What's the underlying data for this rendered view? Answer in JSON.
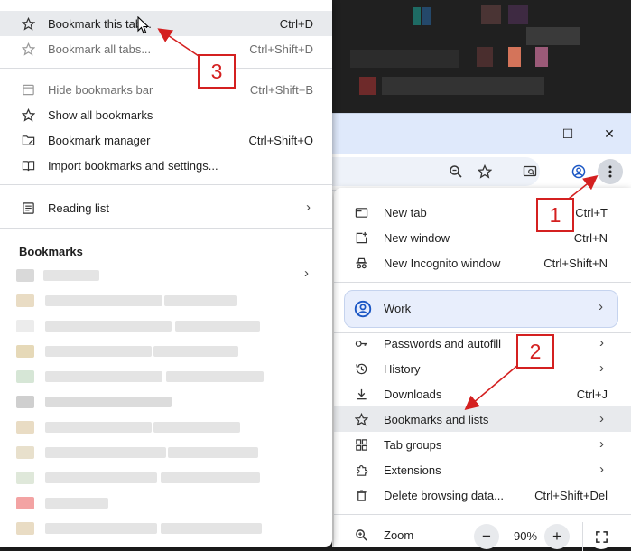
{
  "browser": {
    "window_controls": [
      "minimize",
      "maximize",
      "close"
    ]
  },
  "main_menu": {
    "items": [
      {
        "label": "New tab",
        "shortcut": "Ctrl+T",
        "icon": "new-tab-icon"
      },
      {
        "label": "New window",
        "shortcut": "Ctrl+N",
        "icon": "new-window-icon"
      },
      {
        "label": "New Incognito window",
        "shortcut": "Ctrl+Shift+N",
        "icon": "incognito-icon"
      },
      {
        "label": "Passwords and autofill",
        "icon": "key-icon"
      },
      {
        "label": "History",
        "icon": "history-icon"
      },
      {
        "label": "Downloads",
        "shortcut": "Ctrl+J",
        "icon": "download-icon"
      },
      {
        "label": "Bookmarks and lists",
        "icon": "star-icon",
        "highlighted": true
      },
      {
        "label": "Tab groups",
        "icon": "tab-groups-icon"
      },
      {
        "label": "Extensions",
        "icon": "extensions-icon"
      },
      {
        "label": "Delete browsing data...",
        "shortcut": "Ctrl+Shift+Del",
        "icon": "trash-icon"
      }
    ],
    "profile": {
      "label": "Work"
    },
    "zoom": {
      "label": "Zoom",
      "value": "90%",
      "minus": "−",
      "plus": "+"
    }
  },
  "bookmarks_menu": {
    "items": [
      {
        "label": "Bookmark this tab...",
        "shortcut": "Ctrl+D",
        "highlighted": true
      },
      {
        "label": "Bookmark all tabs...",
        "shortcut": "Ctrl+Shift+D",
        "disabled": true
      },
      {
        "label": "Hide bookmarks bar",
        "shortcut": "Ctrl+Shift+B",
        "disabled": true
      },
      {
        "label": "Show all bookmarks"
      },
      {
        "label": "Bookmark manager",
        "shortcut": "Ctrl+Shift+O"
      },
      {
        "label": "Import bookmarks and settings..."
      },
      {
        "label": "Reading list"
      }
    ],
    "heading": "Bookmarks"
  },
  "annotations": {
    "step1": "1",
    "step2": "2",
    "step3": "3"
  },
  "colors": {
    "annotation": "#d42020",
    "highlight": "#e8eaed",
    "titlebar": "#dfe9fb"
  }
}
